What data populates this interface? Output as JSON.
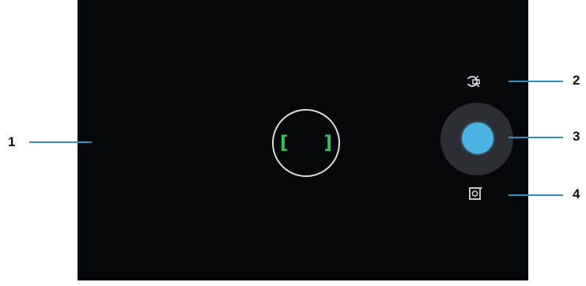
{
  "viewfinder": {
    "focus_left_bracket": "[",
    "focus_right_bracket": "]"
  },
  "controls": {
    "mode_switch_icon": "camera-video-mode-switch-icon",
    "shutter_color": "#4bb2e3",
    "camera_switch_icon": "front-rear-camera-switch-icon"
  },
  "callouts": {
    "one": "1",
    "two": "2",
    "three": "3",
    "four": "4"
  },
  "colors": {
    "screen_background": "#05080b",
    "focus_ring": "#d7dde0",
    "focus_brackets": "#31c45a",
    "callout_lines": "#2e8fc9"
  }
}
